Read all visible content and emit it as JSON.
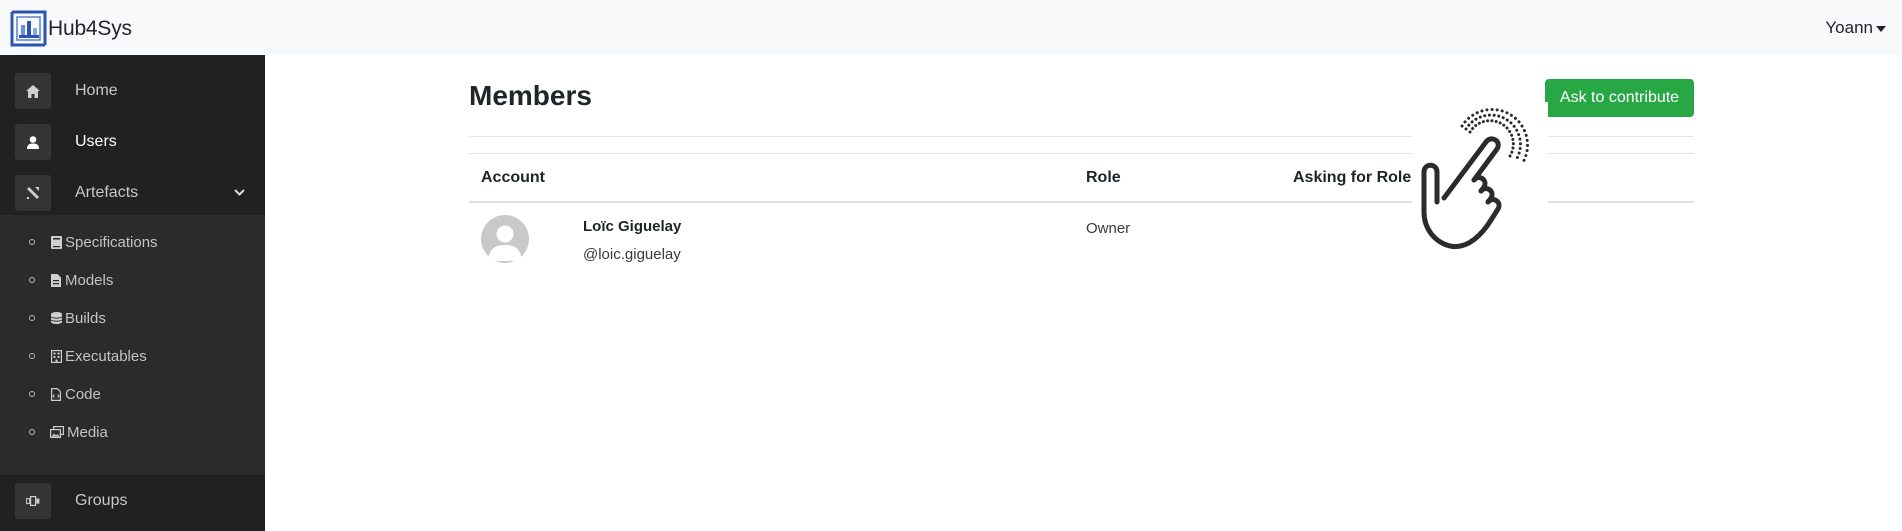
{
  "navbar": {
    "brand": "Hub4Sys",
    "user": "Yoann"
  },
  "sidebar": {
    "items": [
      {
        "label": "Home",
        "icon": "home-icon"
      },
      {
        "label": "Users",
        "icon": "user-icon",
        "active": true
      },
      {
        "label": "Artefacts",
        "icon": "tools-icon",
        "expanded": true
      },
      {
        "label": "Groups",
        "icon": "groups-icon"
      }
    ],
    "artefacts": [
      {
        "label": "Specifications",
        "icon": "book-icon"
      },
      {
        "label": "Models",
        "icon": "file-icon"
      },
      {
        "label": "Builds",
        "icon": "database-icon"
      },
      {
        "label": "Executables",
        "icon": "building-icon"
      },
      {
        "label": "Code",
        "icon": "code-file-icon"
      },
      {
        "label": "Media",
        "icon": "images-icon"
      }
    ]
  },
  "main": {
    "title": "Members",
    "contribute_label": "Ask to contribute",
    "table": {
      "headers": {
        "account": "Account",
        "role": "Role",
        "asking_for_role": "Asking for Role"
      },
      "rows": [
        {
          "name": "Loïc Giguelay",
          "handle": "@loic.giguelay",
          "role": "Owner"
        }
      ]
    }
  },
  "colors": {
    "accent": "#28a745",
    "sidebar": "#212121",
    "subnav": "#2b2b2b",
    "navbar": "#f8f9fa",
    "logo": "#2b55b4"
  },
  "overlay_icon": "tap-hand-icon"
}
